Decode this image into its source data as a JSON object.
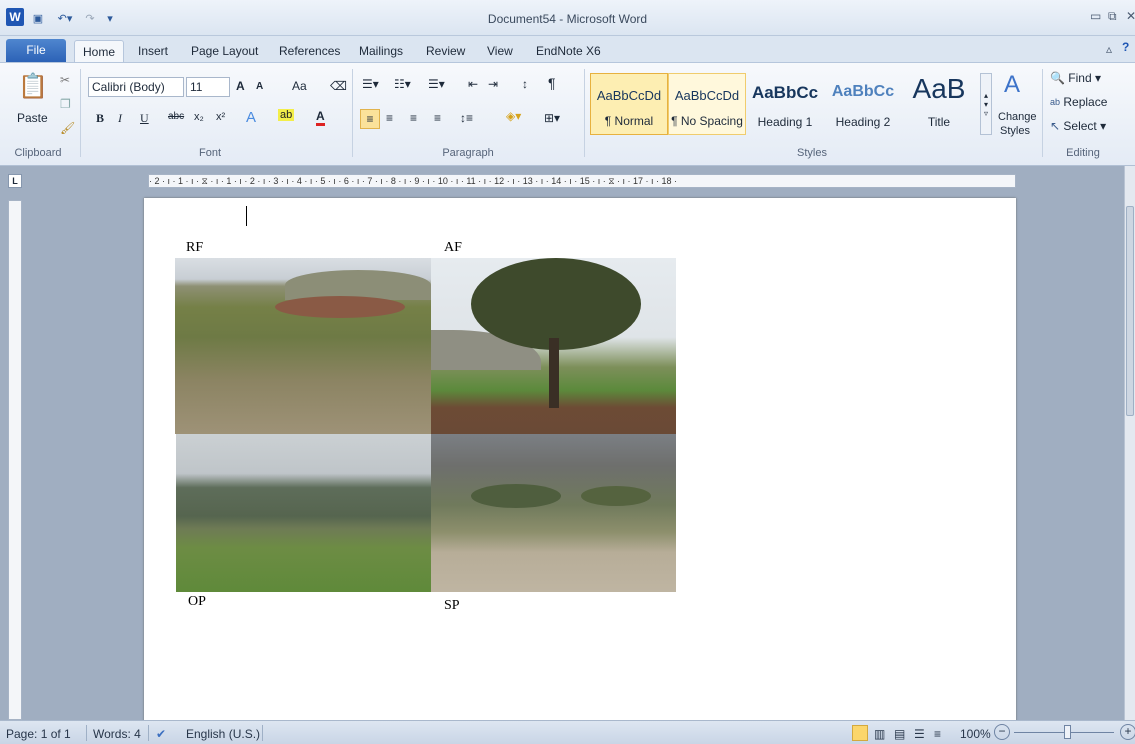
{
  "titlebar": {
    "title": "Document54 - Microsoft Word",
    "app_icon": "W"
  },
  "tabs": {
    "file": "File",
    "items": [
      "Home",
      "Insert",
      "Page Layout",
      "References",
      "Mailings",
      "Review",
      "View",
      "EndNote X6"
    ]
  },
  "ribbon": {
    "clipboard": {
      "paste": "Paste",
      "label": "Clipboard"
    },
    "font": {
      "name": "Calibri (Body)",
      "size": "11",
      "label": "Font",
      "grow": "A",
      "shrink": "A",
      "case": "Aa",
      "bold": "B",
      "italic": "I",
      "underline": "U",
      "strike": "abc",
      "sub": "x₂",
      "sup": "x²"
    },
    "paragraph": {
      "label": "Paragraph"
    },
    "styles": {
      "label": "Styles",
      "items": [
        {
          "sample": "AaBbCcDd",
          "name": "¶ Normal"
        },
        {
          "sample": "AaBbCcDd",
          "name": "¶ No Spacing"
        },
        {
          "sample": "AaBbCc",
          "name": "Heading 1"
        },
        {
          "sample": "AaBbCc",
          "name": "Heading 2"
        },
        {
          "sample": "AaB",
          "name": "Title"
        }
      ],
      "change_styles_1": "Change",
      "change_styles_2": "Styles"
    },
    "editing": {
      "find": "Find",
      "replace": "Replace",
      "select": "Select",
      "label": "Editing"
    }
  },
  "ruler": {
    "text": "· 2 · ı · 1 · ı · ⧖ · ı · 1 · ı · 2 · ı · 3 · ı · 4 · ı · 5 · ı · 6 · ı · 7 · ı · 8 · ı · 9 · ı · 10 · ı · 11 · ı · 12 · ı · 13 · ı · 14 · ı · 15 · ı · ⧖ · ı · 17 · ı · 18 ·"
  },
  "document": {
    "labels": {
      "rf": "RF",
      "af": "AF",
      "op": "OP",
      "sp": "SP"
    }
  },
  "statusbar": {
    "page": "Page: 1 of 1",
    "words": "Words: 4",
    "language": "English (U.S.)",
    "zoom": "100%"
  },
  "colors": {
    "accent": "#2c62b6",
    "style_highlight": "#f6d36d"
  }
}
